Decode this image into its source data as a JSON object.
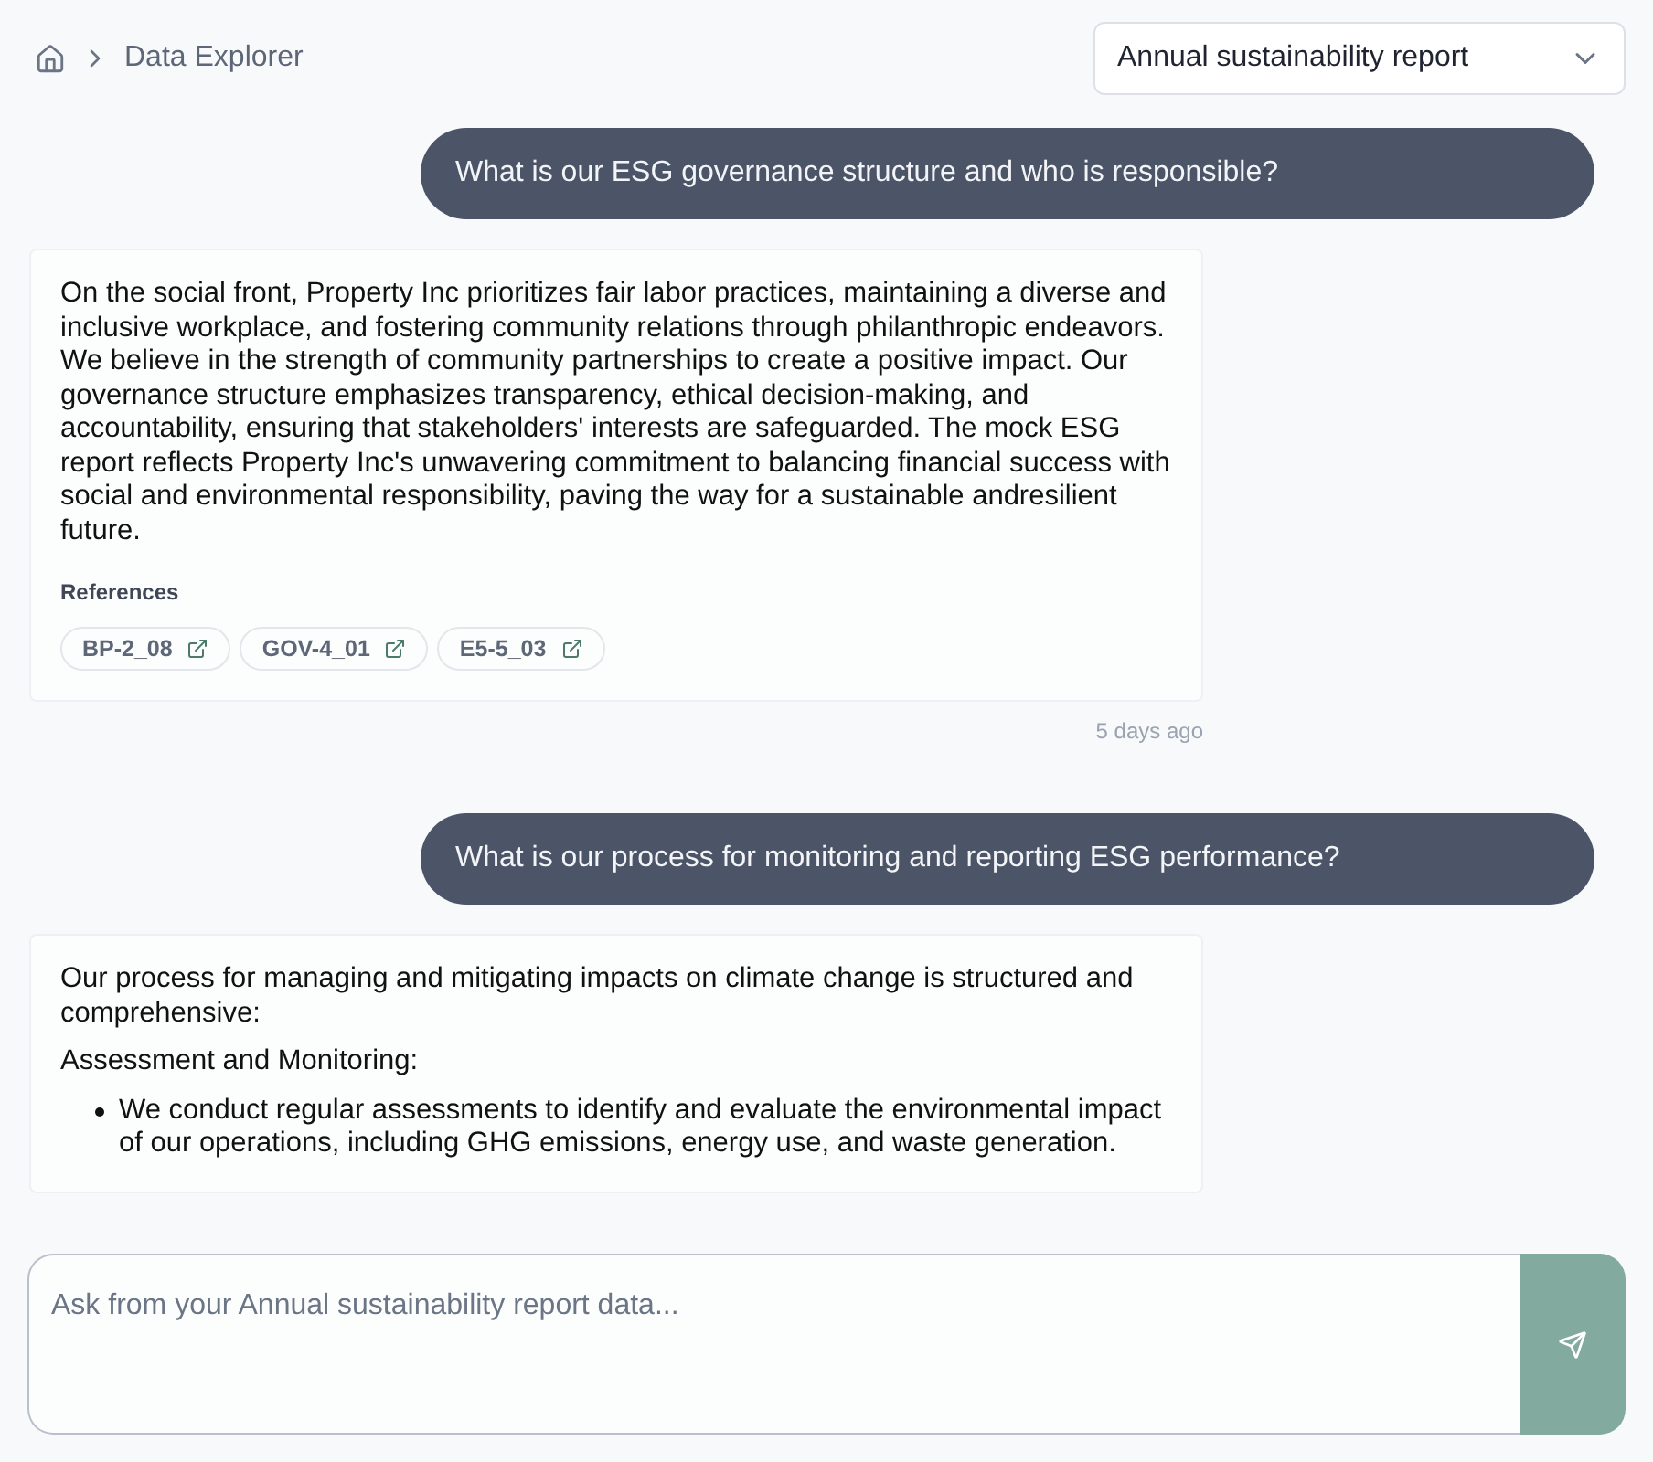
{
  "breadcrumb": {
    "current": "Data Explorer"
  },
  "report_select": {
    "value": "Annual sustainability report"
  },
  "messages": [
    {
      "kind": "user",
      "text": "What is our ESG governance structure and who is responsible?"
    },
    {
      "kind": "answer",
      "paragraphs": [
        "On the social front, Property Inc prioritizes fair labor practices, maintaining a diverse and inclusive workplace, and fostering community relations through philanthropic endeavors. We believe in the strength of community partnerships to create a positive impact. Our governance structure emphasizes transparency, ethical decision-making, and accountability, ensuring that stakeholders' interests are safeguarded. The mock ESG report reflects Property Inc's unwavering commitment to balancing financial success with social and environmental responsibility, paving the way for a sustainable andresilient future."
      ],
      "references_title": "References",
      "references": [
        "BP-2_08",
        "GOV-4_01",
        "E5-5_03"
      ],
      "time": "5 days ago"
    },
    {
      "kind": "user",
      "text": "What is our process for monitoring and reporting ESG performance?"
    },
    {
      "kind": "answer",
      "paragraphs": [
        "Our process for managing and mitigating impacts on climate change is structured and comprehensive:",
        "Assessment and Monitoring:"
      ],
      "bullets": [
        "We conduct regular assessments to identify and evaluate the environmental impact of our operations, including GHG emissions, energy use, and waste generation."
      ]
    }
  ],
  "composer": {
    "placeholder": "Ask from your Annual sustainability report data..."
  }
}
